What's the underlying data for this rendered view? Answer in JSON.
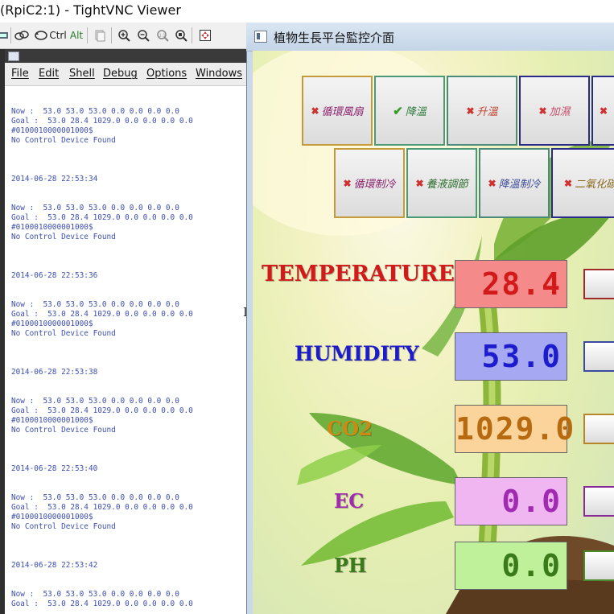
{
  "vnc": {
    "title": "(RpiC2:1) - TightVNC Viewer",
    "toolbar": {
      "ctrl_label": "Ctrl",
      "alt_label": "Alt"
    }
  },
  "shell": {
    "menu": [
      "File",
      "Edit",
      "Shell",
      "Debug",
      "Options",
      "Windows"
    ],
    "log_text": "Now :  53.0 53.0 53.0 0.0 0.0 0.0 0.0\nGoal :  53.0 28.4 1029.0 0.0 0.0 0.0 0.0\n#0100010000001000$\nNo Control Device Found\n\n\n\n2014-06-28 22:53:34\n\n\nNow :  53.0 53.0 53.0 0.0 0.0 0.0 0.0\nGoal :  53.0 28.4 1029.0 0.0 0.0 0.0 0.0\n#0100010000001000$\nNo Control Device Found\n\n\n\n2014-06-28 22:53:36\n\n\nNow :  53.0 53.0 53.0 0.0 0.0 0.0 0.0\nGoal :  53.0 28.4 1029.0 0.0 0.0 0.0 0.0\n#0100010000001000$\nNo Control Device Found\n\n\n\n2014-06-28 22:53:38\n\n\nNow :  53.0 53.0 53.0 0.0 0.0 0.0 0.0\nGoal :  53.0 28.4 1029.0 0.0 0.0 0.0 0.0\n#0100010000001000$\nNo Control Device Found\n\n\n\n2014-06-28 22:53:40\n\n\nNow :  53.0 53.0 53.0 0.0 0.0 0.0 0.0\nGoal :  53.0 28.4 1029.0 0.0 0.0 0.0 0.0\n#0100010000001000$\nNo Control Device Found\n\n\n\n2014-06-28 22:53:42\n\n\nNow :  53.0 53.0 53.0 0.0 0.0 0.0 0.0\nGoal :  53.0 28.4 1029.0 0.0 0.0 0.0 0.0"
  },
  "monitor": {
    "title": "植物生長平台監控介面",
    "buttons_row1": [
      {
        "label": "循環風扇",
        "state": "off",
        "color": "#8a1f6a",
        "border": "#c49a3a"
      },
      {
        "label": "降溫",
        "state": "on",
        "color": "#2a7a3a",
        "border": "#4a9a7a"
      },
      {
        "label": "升溫",
        "state": "off",
        "color": "#c2402a",
        "border": "#4a8a7a"
      },
      {
        "label": "加濕",
        "state": "off",
        "color": "#c44a6a",
        "border": "#2a2a8a"
      },
      {
        "label": "",
        "state": "off",
        "color": "#c44a6a",
        "border": "#2a2a8a"
      }
    ],
    "buttons_row2": [
      {
        "label": "循環制冷",
        "state": "off",
        "color": "#8a1f6a",
        "border": "#c49a3a"
      },
      {
        "label": "養液調節",
        "state": "off",
        "color": "#2a6a2a",
        "border": "#4a9a7a"
      },
      {
        "label": "降溫制冷",
        "state": "off",
        "color": "#3a4a9a",
        "border": "#4a8a7a"
      },
      {
        "label": "二氧化碳",
        "state": "off",
        "color": "#8a6a1a",
        "border": "#2a2a8a"
      }
    ],
    "sensors": [
      {
        "name": "TEMPERATURE",
        "value": "28.4",
        "label_color": "#d21a1a",
        "box_bg": "#f58a8a",
        "box_text": "#d21a1a",
        "side_border": "#a02a2a"
      },
      {
        "name": "HUMIDITY",
        "value": "53.0",
        "label_color": "#1c1ccc",
        "box_bg": "#a6a8f2",
        "box_text": "#1c1ccc",
        "side_border": "#3a4aa0"
      },
      {
        "name": "CO2",
        "value": "1029.0",
        "label_color": "#d08a14",
        "box_bg": "#fad49a",
        "box_text": "#b86a10",
        "side_border": "#b8862a"
      },
      {
        "name": "EC",
        "value": "0.0",
        "label_color": "#a02ab0",
        "box_bg": "#f0b6f2",
        "box_text": "#a02ab0",
        "side_border": "#8a2a9a"
      },
      {
        "name": "PH",
        "value": "0.0",
        "label_color": "#3a7a1a",
        "box_bg": "#bff09a",
        "box_text": "#3a7a1a",
        "side_border": "#4a8a2a"
      }
    ]
  }
}
